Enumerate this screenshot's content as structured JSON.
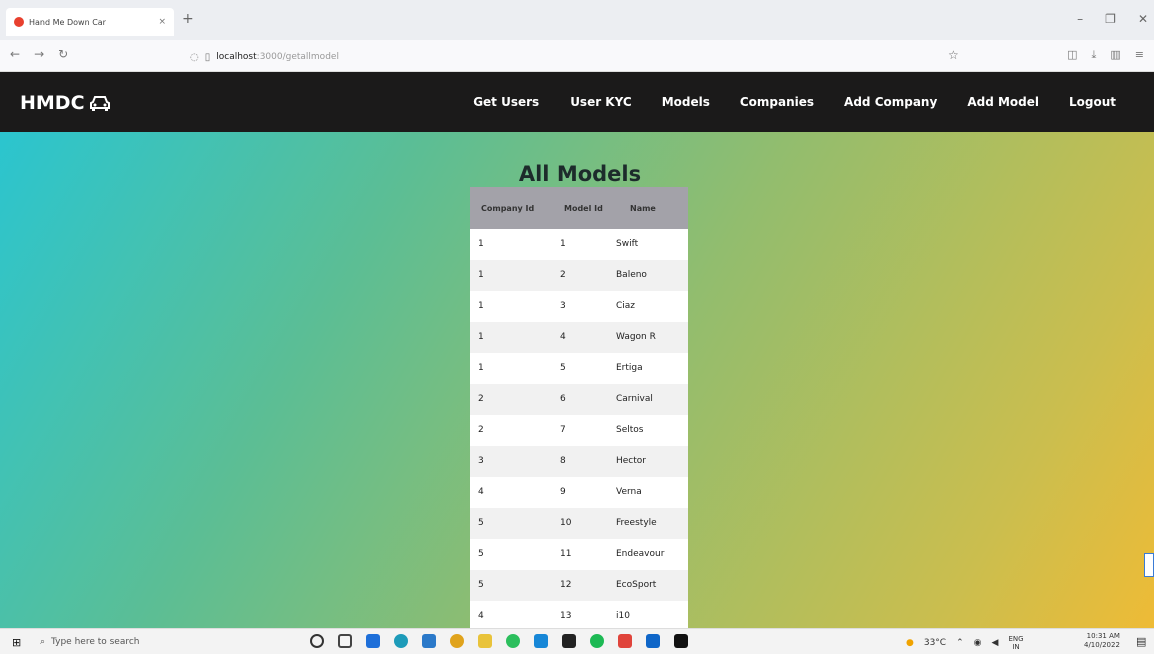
{
  "browser": {
    "tab_title": "Hand Me Down Car",
    "tab_close": "×",
    "new_tab": "+",
    "window_controls": {
      "minimize": "–",
      "restore": "❐",
      "close": "✕"
    },
    "address": {
      "host": "localhost",
      "path": ":3000/getallmodel"
    }
  },
  "app": {
    "brand": "HMDC",
    "brand_icon": "car-icon",
    "nav": [
      "Get Users",
      "User KYC",
      "Models",
      "Companies",
      "Add Company",
      "Add Model",
      "Logout"
    ]
  },
  "page": {
    "title": "All Models",
    "table": {
      "headers": [
        "Company Id",
        "Model Id",
        "Name"
      ],
      "rows": [
        [
          "1",
          "1",
          "Swift"
        ],
        [
          "1",
          "2",
          "Baleno"
        ],
        [
          "1",
          "3",
          "Ciaz"
        ],
        [
          "1",
          "4",
          "Wagon R"
        ],
        [
          "1",
          "5",
          "Ertiga"
        ],
        [
          "2",
          "6",
          "Carnival"
        ],
        [
          "2",
          "7",
          "Seltos"
        ],
        [
          "3",
          "8",
          "Hector"
        ],
        [
          "4",
          "9",
          "Verna"
        ],
        [
          "5",
          "10",
          "Freestyle"
        ],
        [
          "5",
          "11",
          "Endeavour"
        ],
        [
          "5",
          "12",
          "EcoSport"
        ],
        [
          "4",
          "13",
          "i10"
        ]
      ]
    }
  },
  "taskbar": {
    "search_placeholder": "Type here to search",
    "weather": "33°C",
    "language": "ENG",
    "region": "IN",
    "time": "10:31 AM",
    "date": "4/10/2022"
  },
  "colors": {
    "header_bg": "#1b1a1a",
    "table_header_bg": "#a3a2a9",
    "gradient_start": "#2bc5cf",
    "gradient_end": "#eebb36"
  }
}
